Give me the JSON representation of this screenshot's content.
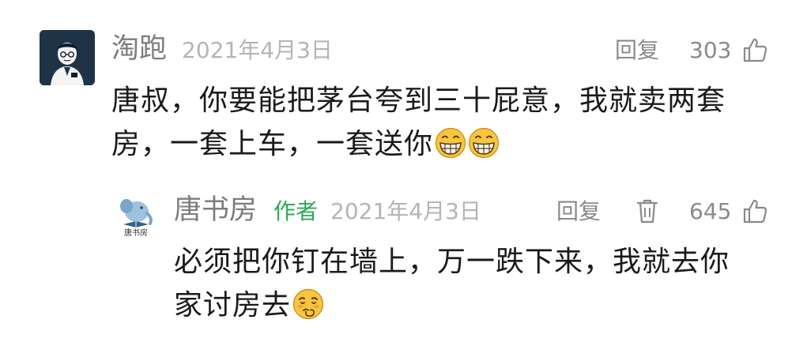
{
  "comment": {
    "author": "淘跑",
    "date": "2021年4月3日",
    "reply_label": "回复",
    "like_count": "303",
    "text_line1": "唐叔，你要能把茅台夸到三十屁意，我就卖两套",
    "text_line2": "房，一套上车，一套送你",
    "emojis": [
      "grin-emoji",
      "grin-emoji"
    ]
  },
  "reply": {
    "author": "唐书房",
    "author_badge": "作者",
    "date": "2021年4月3日",
    "reply_label": "回复",
    "like_count": "645",
    "text_line1": "必须把你钉在墙上，万一跌下来，我就去你",
    "text_line2": "家讨房去",
    "emojis": [
      "shy-emoji"
    ],
    "avatar_caption": "唐书房"
  },
  "colors": {
    "name": "#7d7d7d",
    "date": "#b4b4b4",
    "author_badge": "#2eaa52",
    "action": "#8a8a8a",
    "text": "#1a1a1a",
    "avatar_bg": "#1f3346"
  }
}
